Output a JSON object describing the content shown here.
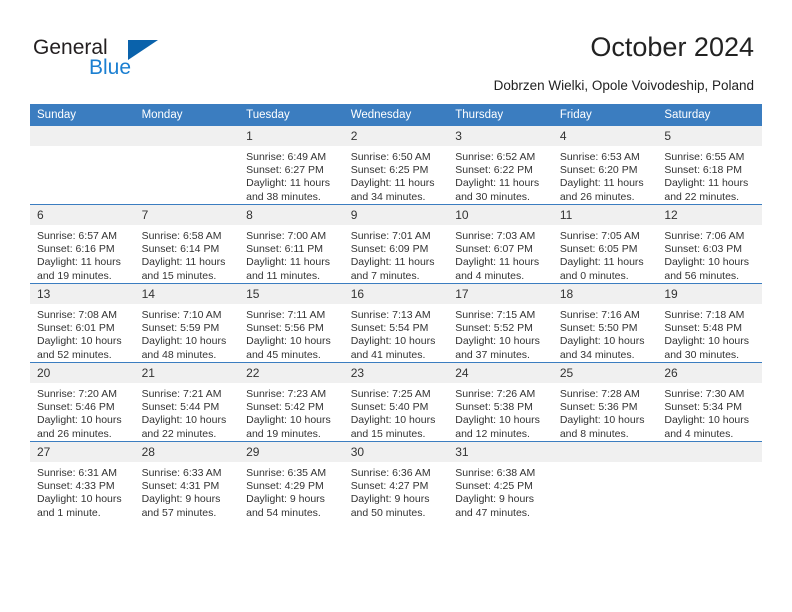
{
  "brand": {
    "name_part1": "General",
    "name_part2": "Blue",
    "triangle_color": "#0a62ab",
    "accent_color": "#1b7fd1"
  },
  "header": {
    "title": "October 2024",
    "subtitle": "Dobrzen Wielki, Opole Voivodeship, Poland"
  },
  "theme": {
    "header_bg": "#3b7dc0",
    "daynum_bg": "#f0f0f0",
    "text_color": "#333333"
  },
  "weekday_headers": [
    "Sunday",
    "Monday",
    "Tuesday",
    "Wednesday",
    "Thursday",
    "Friday",
    "Saturday"
  ],
  "weeks": [
    [
      {
        "day": "",
        "sunrise": "",
        "sunset": "",
        "daylight_line1": "",
        "daylight_line2": "",
        "empty": true
      },
      {
        "day": "",
        "sunrise": "",
        "sunset": "",
        "daylight_line1": "",
        "daylight_line2": "",
        "empty": true
      },
      {
        "day": "1",
        "sunrise": "Sunrise: 6:49 AM",
        "sunset": "Sunset: 6:27 PM",
        "daylight_line1": "Daylight: 11 hours",
        "daylight_line2": "and 38 minutes."
      },
      {
        "day": "2",
        "sunrise": "Sunrise: 6:50 AM",
        "sunset": "Sunset: 6:25 PM",
        "daylight_line1": "Daylight: 11 hours",
        "daylight_line2": "and 34 minutes."
      },
      {
        "day": "3",
        "sunrise": "Sunrise: 6:52 AM",
        "sunset": "Sunset: 6:22 PM",
        "daylight_line1": "Daylight: 11 hours",
        "daylight_line2": "and 30 minutes."
      },
      {
        "day": "4",
        "sunrise": "Sunrise: 6:53 AM",
        "sunset": "Sunset: 6:20 PM",
        "daylight_line1": "Daylight: 11 hours",
        "daylight_line2": "and 26 minutes."
      },
      {
        "day": "5",
        "sunrise": "Sunrise: 6:55 AM",
        "sunset": "Sunset: 6:18 PM",
        "daylight_line1": "Daylight: 11 hours",
        "daylight_line2": "and 22 minutes."
      }
    ],
    [
      {
        "day": "6",
        "sunrise": "Sunrise: 6:57 AM",
        "sunset": "Sunset: 6:16 PM",
        "daylight_line1": "Daylight: 11 hours",
        "daylight_line2": "and 19 minutes."
      },
      {
        "day": "7",
        "sunrise": "Sunrise: 6:58 AM",
        "sunset": "Sunset: 6:14 PM",
        "daylight_line1": "Daylight: 11 hours",
        "daylight_line2": "and 15 minutes."
      },
      {
        "day": "8",
        "sunrise": "Sunrise: 7:00 AM",
        "sunset": "Sunset: 6:11 PM",
        "daylight_line1": "Daylight: 11 hours",
        "daylight_line2": "and 11 minutes."
      },
      {
        "day": "9",
        "sunrise": "Sunrise: 7:01 AM",
        "sunset": "Sunset: 6:09 PM",
        "daylight_line1": "Daylight: 11 hours",
        "daylight_line2": "and 7 minutes."
      },
      {
        "day": "10",
        "sunrise": "Sunrise: 7:03 AM",
        "sunset": "Sunset: 6:07 PM",
        "daylight_line1": "Daylight: 11 hours",
        "daylight_line2": "and 4 minutes."
      },
      {
        "day": "11",
        "sunrise": "Sunrise: 7:05 AM",
        "sunset": "Sunset: 6:05 PM",
        "daylight_line1": "Daylight: 11 hours",
        "daylight_line2": "and 0 minutes."
      },
      {
        "day": "12",
        "sunrise": "Sunrise: 7:06 AM",
        "sunset": "Sunset: 6:03 PM",
        "daylight_line1": "Daylight: 10 hours",
        "daylight_line2": "and 56 minutes."
      }
    ],
    [
      {
        "day": "13",
        "sunrise": "Sunrise: 7:08 AM",
        "sunset": "Sunset: 6:01 PM",
        "daylight_line1": "Daylight: 10 hours",
        "daylight_line2": "and 52 minutes."
      },
      {
        "day": "14",
        "sunrise": "Sunrise: 7:10 AM",
        "sunset": "Sunset: 5:59 PM",
        "daylight_line1": "Daylight: 10 hours",
        "daylight_line2": "and 48 minutes."
      },
      {
        "day": "15",
        "sunrise": "Sunrise: 7:11 AM",
        "sunset": "Sunset: 5:56 PM",
        "daylight_line1": "Daylight: 10 hours",
        "daylight_line2": "and 45 minutes."
      },
      {
        "day": "16",
        "sunrise": "Sunrise: 7:13 AM",
        "sunset": "Sunset: 5:54 PM",
        "daylight_line1": "Daylight: 10 hours",
        "daylight_line2": "and 41 minutes."
      },
      {
        "day": "17",
        "sunrise": "Sunrise: 7:15 AM",
        "sunset": "Sunset: 5:52 PM",
        "daylight_line1": "Daylight: 10 hours",
        "daylight_line2": "and 37 minutes."
      },
      {
        "day": "18",
        "sunrise": "Sunrise: 7:16 AM",
        "sunset": "Sunset: 5:50 PM",
        "daylight_line1": "Daylight: 10 hours",
        "daylight_line2": "and 34 minutes."
      },
      {
        "day": "19",
        "sunrise": "Sunrise: 7:18 AM",
        "sunset": "Sunset: 5:48 PM",
        "daylight_line1": "Daylight: 10 hours",
        "daylight_line2": "and 30 minutes."
      }
    ],
    [
      {
        "day": "20",
        "sunrise": "Sunrise: 7:20 AM",
        "sunset": "Sunset: 5:46 PM",
        "daylight_line1": "Daylight: 10 hours",
        "daylight_line2": "and 26 minutes."
      },
      {
        "day": "21",
        "sunrise": "Sunrise: 7:21 AM",
        "sunset": "Sunset: 5:44 PM",
        "daylight_line1": "Daylight: 10 hours",
        "daylight_line2": "and 22 minutes."
      },
      {
        "day": "22",
        "sunrise": "Sunrise: 7:23 AM",
        "sunset": "Sunset: 5:42 PM",
        "daylight_line1": "Daylight: 10 hours",
        "daylight_line2": "and 19 minutes."
      },
      {
        "day": "23",
        "sunrise": "Sunrise: 7:25 AM",
        "sunset": "Sunset: 5:40 PM",
        "daylight_line1": "Daylight: 10 hours",
        "daylight_line2": "and 15 minutes."
      },
      {
        "day": "24",
        "sunrise": "Sunrise: 7:26 AM",
        "sunset": "Sunset: 5:38 PM",
        "daylight_line1": "Daylight: 10 hours",
        "daylight_line2": "and 12 minutes."
      },
      {
        "day": "25",
        "sunrise": "Sunrise: 7:28 AM",
        "sunset": "Sunset: 5:36 PM",
        "daylight_line1": "Daylight: 10 hours",
        "daylight_line2": "and 8 minutes."
      },
      {
        "day": "26",
        "sunrise": "Sunrise: 7:30 AM",
        "sunset": "Sunset: 5:34 PM",
        "daylight_line1": "Daylight: 10 hours",
        "daylight_line2": "and 4 minutes."
      }
    ],
    [
      {
        "day": "27",
        "sunrise": "Sunrise: 6:31 AM",
        "sunset": "Sunset: 4:33 PM",
        "daylight_line1": "Daylight: 10 hours",
        "daylight_line2": "and 1 minute."
      },
      {
        "day": "28",
        "sunrise": "Sunrise: 6:33 AM",
        "sunset": "Sunset: 4:31 PM",
        "daylight_line1": "Daylight: 9 hours",
        "daylight_line2": "and 57 minutes."
      },
      {
        "day": "29",
        "sunrise": "Sunrise: 6:35 AM",
        "sunset": "Sunset: 4:29 PM",
        "daylight_line1": "Daylight: 9 hours",
        "daylight_line2": "and 54 minutes."
      },
      {
        "day": "30",
        "sunrise": "Sunrise: 6:36 AM",
        "sunset": "Sunset: 4:27 PM",
        "daylight_line1": "Daylight: 9 hours",
        "daylight_line2": "and 50 minutes."
      },
      {
        "day": "31",
        "sunrise": "Sunrise: 6:38 AM",
        "sunset": "Sunset: 4:25 PM",
        "daylight_line1": "Daylight: 9 hours",
        "daylight_line2": "and 47 minutes."
      },
      {
        "day": "",
        "sunrise": "",
        "sunset": "",
        "daylight_line1": "",
        "daylight_line2": "",
        "empty": true
      },
      {
        "day": "",
        "sunrise": "",
        "sunset": "",
        "daylight_line1": "",
        "daylight_line2": "",
        "empty": true
      }
    ]
  ]
}
